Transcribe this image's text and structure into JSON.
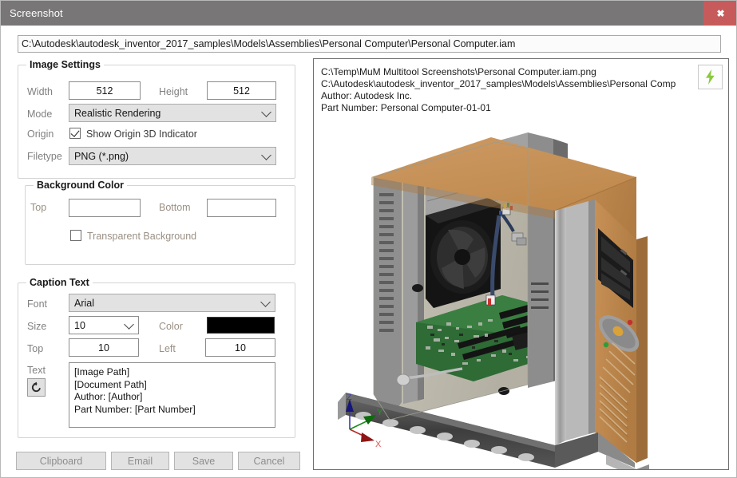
{
  "window": {
    "title": "Screenshot",
    "close_label": "✖"
  },
  "path_bar": {
    "value": "C:\\Autodesk\\autodesk_inventor_2017_samples\\Models\\Assemblies\\Personal Computer\\Personal Computer.iam"
  },
  "image_settings": {
    "legend": "Image Settings",
    "width_label": "Width",
    "width_value": "512",
    "height_label": "Height",
    "height_value": "512",
    "mode_label": "Mode",
    "mode_value": "Realistic Rendering",
    "origin_label": "Origin",
    "origin_checkbox_label": "Show Origin 3D Indicator",
    "origin_checked": true,
    "filetype_label": "Filetype",
    "filetype_value": "PNG (*.png)"
  },
  "background_color": {
    "legend": "Background Color",
    "top_label": "Top",
    "top_value": "",
    "bottom_label": "Bottom",
    "bottom_value": "",
    "transparent_label": "Transparent Background",
    "transparent_checked": false
  },
  "caption_text": {
    "legend": "Caption Text",
    "font_label": "Font",
    "font_value": "Arial",
    "size_label": "Size",
    "size_value": "10",
    "color_label": "Color",
    "color_value": "#000000",
    "top_label": "Top",
    "top_value": "10",
    "left_label": "Left",
    "left_value": "10",
    "text_label": "Text",
    "reset_icon": "reset-arrow-icon",
    "text_value": "[Image Path]\n[Document Path]\nAuthor: [Author]\nPart Number: [Part Number]"
  },
  "buttons": {
    "clipboard": "Clipboard",
    "email": "Email",
    "save": "Save",
    "cancel": "Cancel"
  },
  "preview": {
    "caption_overlay": "C:\\Temp\\MuM Multitool Screenshots\\Personal Computer.iam.png\nC:\\Autodesk\\autodesk_inventor_2017_samples\\Models\\Assemblies\\Personal Comp\nAuthor: Autodesk Inc.\nPart Number: Personal Computer-01-01",
    "flash_icon": "lightning-bolt-icon",
    "axis_z": "Z",
    "axis_y": "Y",
    "axis_x": "X",
    "model_name": "personal-computer-assembly"
  },
  "colors": {
    "titlebar": "#787677",
    "close": "#c75b5b",
    "case_tan": "#c08a4e",
    "case_tan_light": "#c99760",
    "metal": "#a8a8a8",
    "metal_dark": "#6f6f6f",
    "pcb_green": "#2e6b35",
    "bolt_green": "#8ac93a",
    "axis_x": "#cc2222",
    "axis_y": "#119911",
    "axis_z": "#1a1a99"
  }
}
